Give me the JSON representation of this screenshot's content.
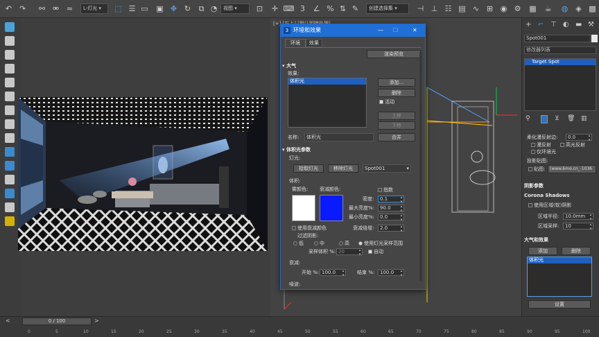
{
  "toolbar": {
    "layer_select": "L-灯光",
    "view_select": "视图",
    "selection_set": "创建选择集"
  },
  "timeline": {
    "frame_readout": "0 / 100",
    "ticks": [
      "0",
      "5",
      "10",
      "15",
      "20",
      "25",
      "30",
      "35",
      "40",
      "45",
      "50",
      "55",
      "60",
      "65",
      "70",
      "75",
      "80",
      "85",
      "90",
      "95",
      "100"
    ]
  },
  "viewport": {
    "label": "[+] [左上] [默认明暗处理]"
  },
  "dialog": {
    "title": "环境和效果",
    "tabs": [
      "环境",
      "效果"
    ],
    "preview_button": "渲染预览",
    "atmo_header": "大气",
    "effects_label": "效果:",
    "effects_list": [
      "体积光"
    ],
    "add_button": "添加...",
    "delete_button": "删除",
    "active_check": "活动",
    "up_button": "上移",
    "down_button": "下移",
    "name_label": "名称:",
    "name_value": "体积光",
    "merge_button": "合并",
    "vl_header": "体积光参数",
    "lights_label": "灯光:",
    "pick_light": "拾取灯光",
    "remove_light": "移除灯光",
    "light_select": "Spot001",
    "volume_label": "体积:",
    "fog_color_label": "雾颜色:",
    "atten_color_label": "衰减颜色:",
    "fog_color": "#ffffff",
    "atten_color": "#0a1aff",
    "exp_check": "指数",
    "density_label": "密度:",
    "density_value": "0.1",
    "max_bright_label": "最大亮度%:",
    "max_bright_value": "90.0",
    "min_bright_label": "最小亮度%:",
    "min_bright_value": "0.0",
    "use_atten_color": "使用衰减颜色",
    "atten_mult_label": "衰减倍增:",
    "atten_mult_value": "2.0",
    "filter_shadows": "过滤阴影:",
    "radio_low": "低",
    "radio_mid": "中",
    "radio_high": "高",
    "radio_use_light": "使用灯光采样范围",
    "sample_label": "采样体积 %:",
    "sample_value": "20",
    "auto_check": "自动",
    "atten_label": "衰减:",
    "start_label": "开始 %:",
    "start_value": "100.0",
    "end_label": "结束 %:",
    "end_value": "100.0",
    "noise_label": "噪波:"
  },
  "right_panel": {
    "object_name": "Spot001",
    "modifier_list": "修改器列表",
    "stack_item": "Target Spot",
    "falloff_label": "柔化漫反射边:",
    "falloff_value": "0.0",
    "contrast_check": "漫反射",
    "specular_check": "高光反射",
    "ambient_check": "仅环境光",
    "projector_label": "投影贴图:",
    "map_check": "贴图:",
    "map_value": "(www.6mo.cn_-1036",
    "shadow_params": "阴影参数",
    "corona_shadows": "Corona Shadows",
    "use_area_shadow": "使用区域(软)阴影",
    "area_radius_label": "区域半径:",
    "area_radius_value": "10.0mm",
    "area_samples_label": "区域采样:",
    "area_samples_value": "10",
    "atmos_header": "大气和效果",
    "add_button": "添加",
    "delete_button": "删除",
    "effect_item": "体积光",
    "setup_button": "设置"
  },
  "colors": {
    "title_blue": "#1f6fd6",
    "selection_blue": "#1e5fbf"
  }
}
